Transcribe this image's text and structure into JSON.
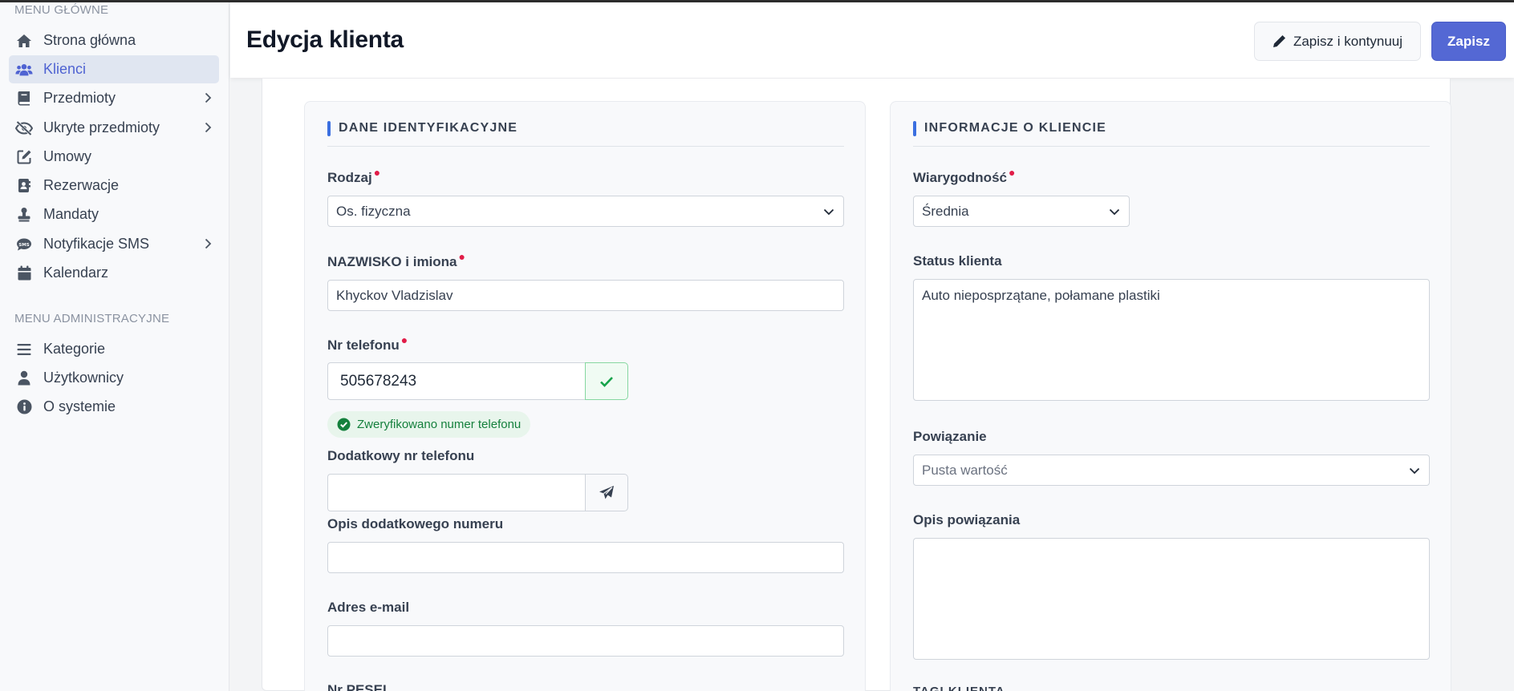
{
  "sidebar": {
    "main_menu_label": "MENU GŁÓWNE",
    "admin_menu_label": "MENU ADMINISTRACYJNE",
    "items": [
      {
        "label": "Strona główna"
      },
      {
        "label": "Klienci"
      },
      {
        "label": "Przedmioty"
      },
      {
        "label": "Ukryte przedmioty"
      },
      {
        "label": "Umowy"
      },
      {
        "label": "Rezerwacje"
      },
      {
        "label": "Mandaty"
      },
      {
        "label": "Notyfikacje SMS"
      },
      {
        "label": "Kalendarz"
      }
    ],
    "admin_items": [
      {
        "label": "Kategorie"
      },
      {
        "label": "Użytkownicy"
      },
      {
        "label": "O systemie"
      }
    ]
  },
  "header": {
    "title": "Edycja klienta",
    "save_continue_label": "Zapisz i kontynuuj",
    "save_label": "Zapisz"
  },
  "left_panel": {
    "title": "DANE IDENTYFIKACYJNE",
    "type_label": "Rodzaj",
    "type_value": "Os. fizyczna",
    "name_label": "NAZWISKO i imiona",
    "name_value": "Khyckov Vladzislav",
    "phone_label": "Nr telefonu",
    "phone_value": "505678243",
    "phone_verified": "Zweryfikowano numer telefonu",
    "extra_phone_label": "Dodatkowy nr telefonu",
    "extra_phone_value": "",
    "extra_phone_desc_label": "Opis dodatkowego numeru",
    "extra_phone_desc_value": "",
    "email_label": "Adres e-mail",
    "email_value": "",
    "pesel_label": "Nr PESEL"
  },
  "right_panel": {
    "title": "INFORMACJE O KLIENCIE",
    "credibility_label": "Wiarygodność",
    "credibility_value": "Średnia",
    "status_label": "Status klienta",
    "status_value": "Auto nieposprzątane, połamane plastiki",
    "relation_label": "Powiązanie",
    "relation_placeholder": "Pusta wartość",
    "relation_desc_label": "Opis powiązania",
    "relation_desc_value": "",
    "tags_label": "TAGI KLIENTA"
  },
  "colors": {
    "accent": "#5468d4",
    "active_nav_bg": "#e0e6f1",
    "verified_green": "#15803d",
    "required_marker": "#e11d48"
  }
}
